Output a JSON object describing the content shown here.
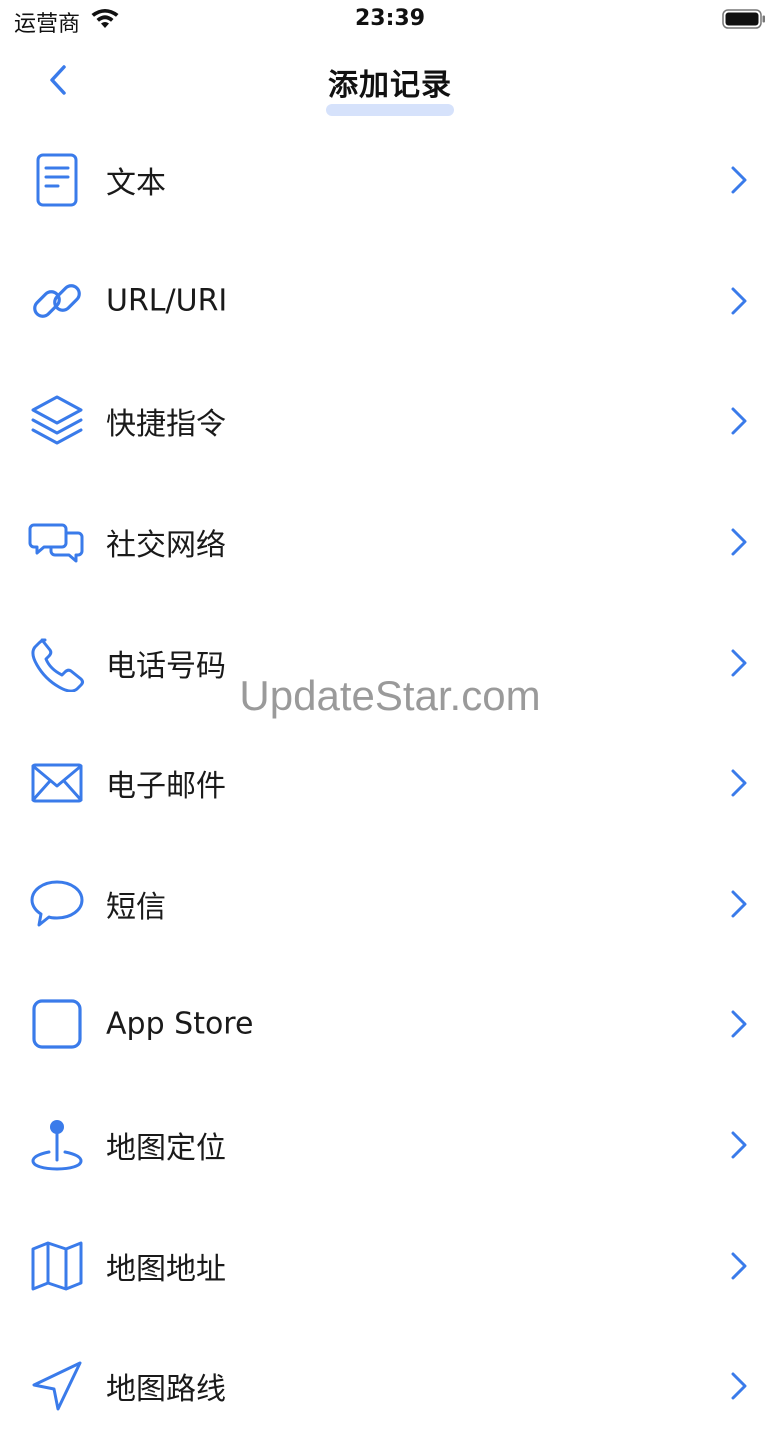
{
  "status_bar": {
    "carrier": "运营商",
    "time": "23:39"
  },
  "nav": {
    "title": "添加记录"
  },
  "accent_color": "#3a7bea",
  "items": [
    {
      "label": "文本",
      "icon": "document-icon"
    },
    {
      "label": "URL/URI",
      "icon": "link-icon"
    },
    {
      "label": "快捷指令",
      "icon": "layers-icon"
    },
    {
      "label": "社交网络",
      "icon": "chat-bubbles-icon"
    },
    {
      "label": "电话号码",
      "icon": "phone-icon"
    },
    {
      "label": "电子邮件",
      "icon": "envelope-icon"
    },
    {
      "label": "短信",
      "icon": "message-icon"
    },
    {
      "label": "App Store",
      "icon": "app-square-icon"
    },
    {
      "label": "地图定位",
      "icon": "map-pin-icon"
    },
    {
      "label": "地图地址",
      "icon": "map-icon"
    },
    {
      "label": "地图路线",
      "icon": "navigation-arrow-icon"
    }
  ],
  "watermark": "UpdateStar.com"
}
